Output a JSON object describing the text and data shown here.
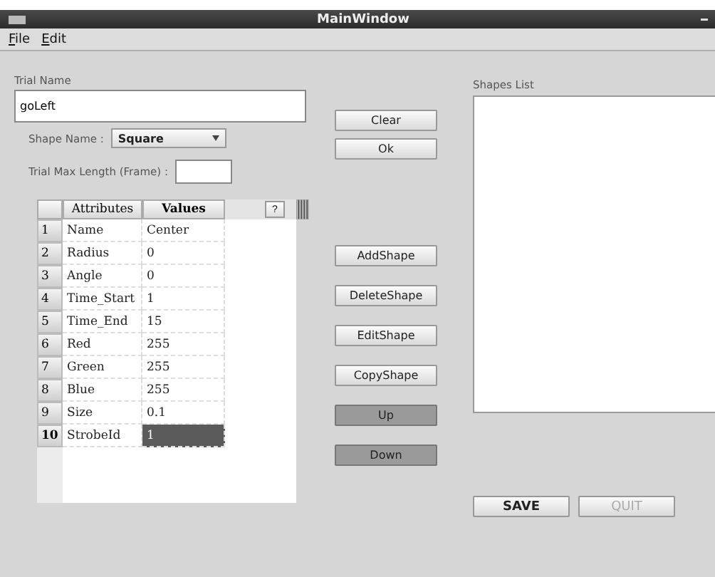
{
  "window": {
    "title": "MainWindow"
  },
  "menu": [
    {
      "label": "File"
    },
    {
      "label": "Edit"
    }
  ],
  "trial_name": {
    "label": "Trial Name",
    "value": "goLeft"
  },
  "shape_name": {
    "label": "Shape Name :",
    "value": "Square"
  },
  "trial_max_length": {
    "label": "Trial Max Length (Frame) :"
  },
  "table": {
    "columns": [
      "Attributes",
      "Values"
    ],
    "help_button": "?",
    "rows": [
      {
        "number": "1",
        "attribute": "Name",
        "value": "Center",
        "selected": false
      },
      {
        "number": "2",
        "attribute": "Radius",
        "value": "0",
        "selected": false
      },
      {
        "number": "3",
        "attribute": "Angle",
        "value": "0",
        "selected": false
      },
      {
        "number": "4",
        "attribute": "Time_Start",
        "value": "1",
        "selected": false
      },
      {
        "number": "5",
        "attribute": "Time_End",
        "value": "15",
        "selected": false
      },
      {
        "number": "6",
        "attribute": "Red",
        "value": "255",
        "selected": false
      },
      {
        "number": "7",
        "attribute": "Green",
        "value": "255",
        "selected": false
      },
      {
        "number": "8",
        "attribute": "Blue",
        "value": "255",
        "selected": false
      },
      {
        "number": "9",
        "attribute": "Size",
        "value": "0.1",
        "selected": false
      },
      {
        "number": "10",
        "attribute": "StrobeId",
        "value": "1",
        "selected": true
      }
    ]
  },
  "top_buttons": [
    {
      "label": "Clear"
    },
    {
      "label": "Ok"
    }
  ],
  "shape_buttons": [
    {
      "label": "AddShape",
      "kind": "normal"
    },
    {
      "label": "DeleteShape",
      "kind": "normal"
    },
    {
      "label": "EditShape",
      "kind": "normal"
    },
    {
      "label": "CopyShape",
      "kind": "normal"
    },
    {
      "label": "Up",
      "kind": "dark"
    },
    {
      "label": "Down",
      "kind": "dark"
    }
  ],
  "shapes_list": {
    "label": "Shapes List"
  },
  "bottom_buttons": [
    {
      "label": "SAVE",
      "disabled": false
    },
    {
      "label": "QUIT",
      "disabled": true
    }
  ]
}
